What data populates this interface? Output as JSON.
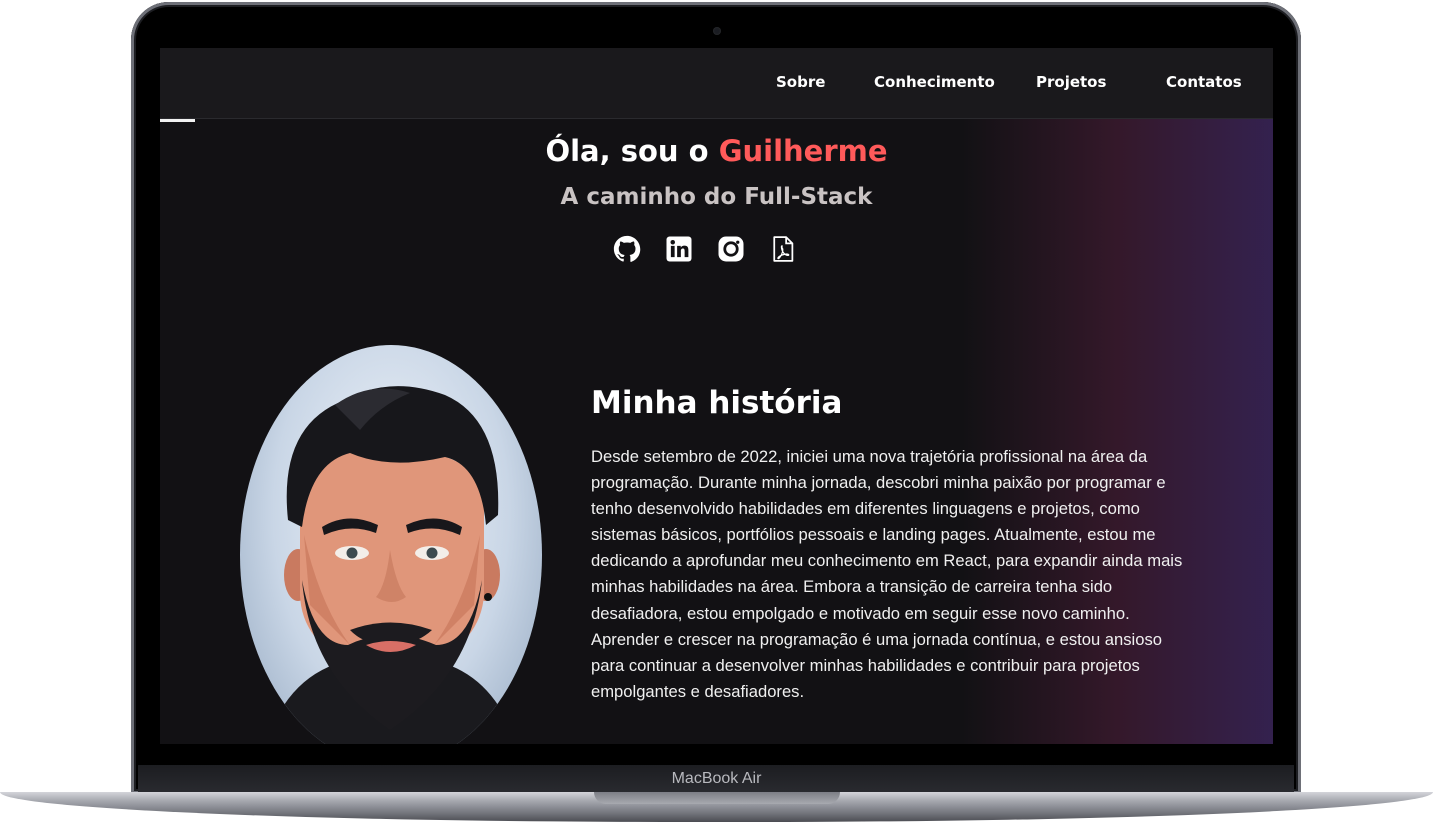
{
  "device": {
    "brand_label": "MacBook Air"
  },
  "nav": {
    "items": [
      {
        "label": "Sobre"
      },
      {
        "label": "Conhecimento"
      },
      {
        "label": "Projetos"
      },
      {
        "label": "Contatos"
      }
    ]
  },
  "hero": {
    "greeting": "Óla, sou o ",
    "name": "Guilherme",
    "subtitle": "A caminho do Full-Stack",
    "socials": [
      {
        "icon": "github-icon"
      },
      {
        "icon": "linkedin-icon"
      },
      {
        "icon": "instagram-icon"
      },
      {
        "icon": "pdf-icon"
      }
    ]
  },
  "history": {
    "title": "Minha história",
    "text": "Desde setembro de 2022, iniciei uma nova trajetória profissional na área da programação. Durante minha jornada, descobri minha paixão por programar e tenho desenvolvido habilidades em diferentes linguagens e projetos, como sistemas básicos, portfólios pessoais e landing pages. Atualmente, estou me dedicando a aprofundar meu conhecimento em React, para expandir ainda mais minhas habilidades na área. Embora a transição de carreira tenha sido desafiadora, estou empolgado e motivado em seguir esse novo caminho. Aprender e crescer na programação é uma jornada contínua, e estou ansioso para continuar a desenvolver minhas habilidades e contribuir para projetos empolgantes e desafiadores."
  },
  "colors": {
    "accent": "#ff5a5a",
    "background": "#121114",
    "gradient_end": "#372355"
  }
}
